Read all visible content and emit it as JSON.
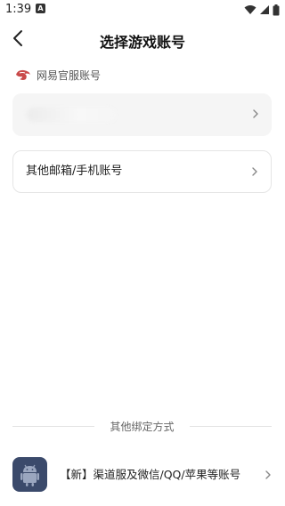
{
  "status_bar": {
    "time": "1:39",
    "notification_letter": "A"
  },
  "header": {
    "title": "选择游戏账号"
  },
  "netease_section": {
    "label": "网易官服账号"
  },
  "other_account": {
    "label": "其他邮箱/手机账号"
  },
  "divider": {
    "label": "其他绑定方式"
  },
  "channel_bind": {
    "label": "【新】渠道服及微信/QQ/苹果等账号"
  },
  "colors": {
    "accent_logo": "#c94a4a",
    "android_bg": "#3b4a6b"
  },
  "icons": [
    "back-arrow-icon",
    "netease-logo-icon",
    "chevron-right-icon",
    "android-icon",
    "wifi-icon",
    "signal-icon",
    "battery-icon"
  ]
}
